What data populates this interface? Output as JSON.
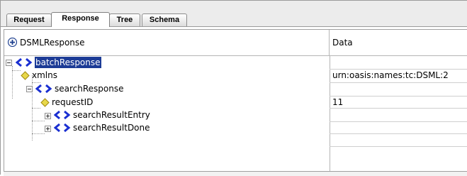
{
  "tabs": [
    {
      "label": "Request",
      "active": false
    },
    {
      "label": "Response",
      "active": true
    },
    {
      "label": "Tree",
      "active": false
    },
    {
      "label": "Schema",
      "active": false
    }
  ],
  "table": {
    "columns": [
      "DSMLResponse",
      "Data"
    ]
  },
  "tree": [
    {
      "label": "batchResponse",
      "kind": "element",
      "expander": "collapse",
      "selected": true,
      "data": ""
    },
    {
      "label": "xmlns",
      "kind": "attribute",
      "expander": "none",
      "selected": false,
      "data": "urn:oasis:names:tc:DSML:2"
    },
    {
      "label": "searchResponse",
      "kind": "element",
      "expander": "collapse",
      "selected": false,
      "data": ""
    },
    {
      "label": "requestID",
      "kind": "attribute",
      "expander": "none",
      "selected": false,
      "data": "11"
    },
    {
      "label": "searchResultEntry",
      "kind": "element",
      "expander": "expand",
      "selected": false,
      "data": ""
    },
    {
      "label": "searchResultDone",
      "kind": "element",
      "expander": "expand",
      "selected": false,
      "data": ""
    }
  ],
  "colors": {
    "selection": "#1c3b96",
    "element_icon": "#1a2fd1",
    "attribute_icon": "#e8d84a"
  },
  "icons": {
    "header": "add-circle-icon",
    "element": "xml-element-icon",
    "attribute": "xml-attribute-icon",
    "expand": "expand-box-icon",
    "collapse": "collapse-box-icon"
  }
}
